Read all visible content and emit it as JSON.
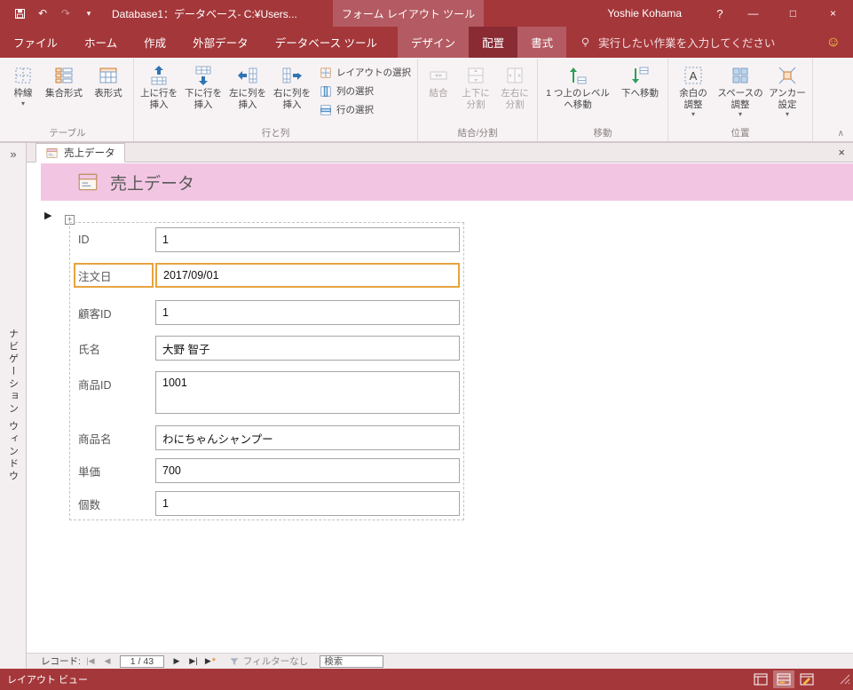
{
  "title_bar": {
    "title": "Database1：データベース- C:¥Users...",
    "contextual": "フォーム レイアウト ツール",
    "user": "Yoshie Kohama"
  },
  "tabs": [
    {
      "label": "ファイル"
    },
    {
      "label": "ホーム"
    },
    {
      "label": "作成"
    },
    {
      "label": "外部データ"
    },
    {
      "label": "データベース ツール"
    },
    {
      "label": "デザイン"
    },
    {
      "label": "配置"
    },
    {
      "label": "書式"
    }
  ],
  "tell_me": "実行したい作業を入力してください",
  "ribbon": {
    "table_group": {
      "label": "テーブル",
      "gridlines": "枠線",
      "stacked": "集合形式",
      "tabular": "表形式"
    },
    "rows_cols_group": {
      "label": "行と列",
      "insert_above": "上に行を\n挿入",
      "insert_below": "下に行を\n挿入",
      "insert_left": "左に列を\n挿入",
      "insert_right": "右に列を\n挿入",
      "select_layout": "レイアウトの選択",
      "select_column": "列の選択",
      "select_row": "行の選択"
    },
    "merge_split_group": {
      "label": "結合/分割",
      "merge": "結合",
      "split_vertical": "上下に\n分割",
      "split_horizontal": "左右に\n分割"
    },
    "move_group": {
      "label": "移動",
      "move_up": "1 つ上のレベル\nへ移動",
      "move_down": "下へ移動"
    },
    "position_group": {
      "label": "位置",
      "margins": "余白の\n調整",
      "padding": "スペースの\n調整",
      "anchoring": "アンカー\n設定"
    }
  },
  "document": {
    "tab": "売上データ",
    "header": "売上データ",
    "nav_pane": "ナビゲーション ウィンドウ"
  },
  "form": {
    "fields": [
      {
        "label": "ID",
        "value": "1"
      },
      {
        "label": "注文日",
        "value": "2017/09/01"
      },
      {
        "label": "顧客ID",
        "value": "1"
      },
      {
        "label": "氏名",
        "value": "大野 智子"
      },
      {
        "label": "商品ID",
        "value": "1001"
      },
      {
        "label": "商品名",
        "value": "わにちゃんシャンプー"
      },
      {
        "label": "単価",
        "value": "700"
      },
      {
        "label": "個数",
        "value": "1"
      }
    ]
  },
  "record_nav": {
    "label": "レコード:",
    "position": "1 / 43",
    "filter": "フィルターなし",
    "search": "検索"
  },
  "status": {
    "view": "レイアウト ビュー"
  },
  "icons": {
    "dropdown": "▾",
    "undo": "↶",
    "redo": "↷",
    "help": "?",
    "minimize": "—",
    "maximize": "□",
    "close": "×",
    "smiley": "☺",
    "collapse_ribbon": "∧",
    "expand_nav": "»",
    "doc_close": "×",
    "record_selector": "▶",
    "plus": "+",
    "nav_first": "|◀",
    "nav_prev": "◀",
    "nav_next": "▶",
    "nav_last": "▶|",
    "nav_new": "▶",
    "nav_new_star": "*"
  }
}
